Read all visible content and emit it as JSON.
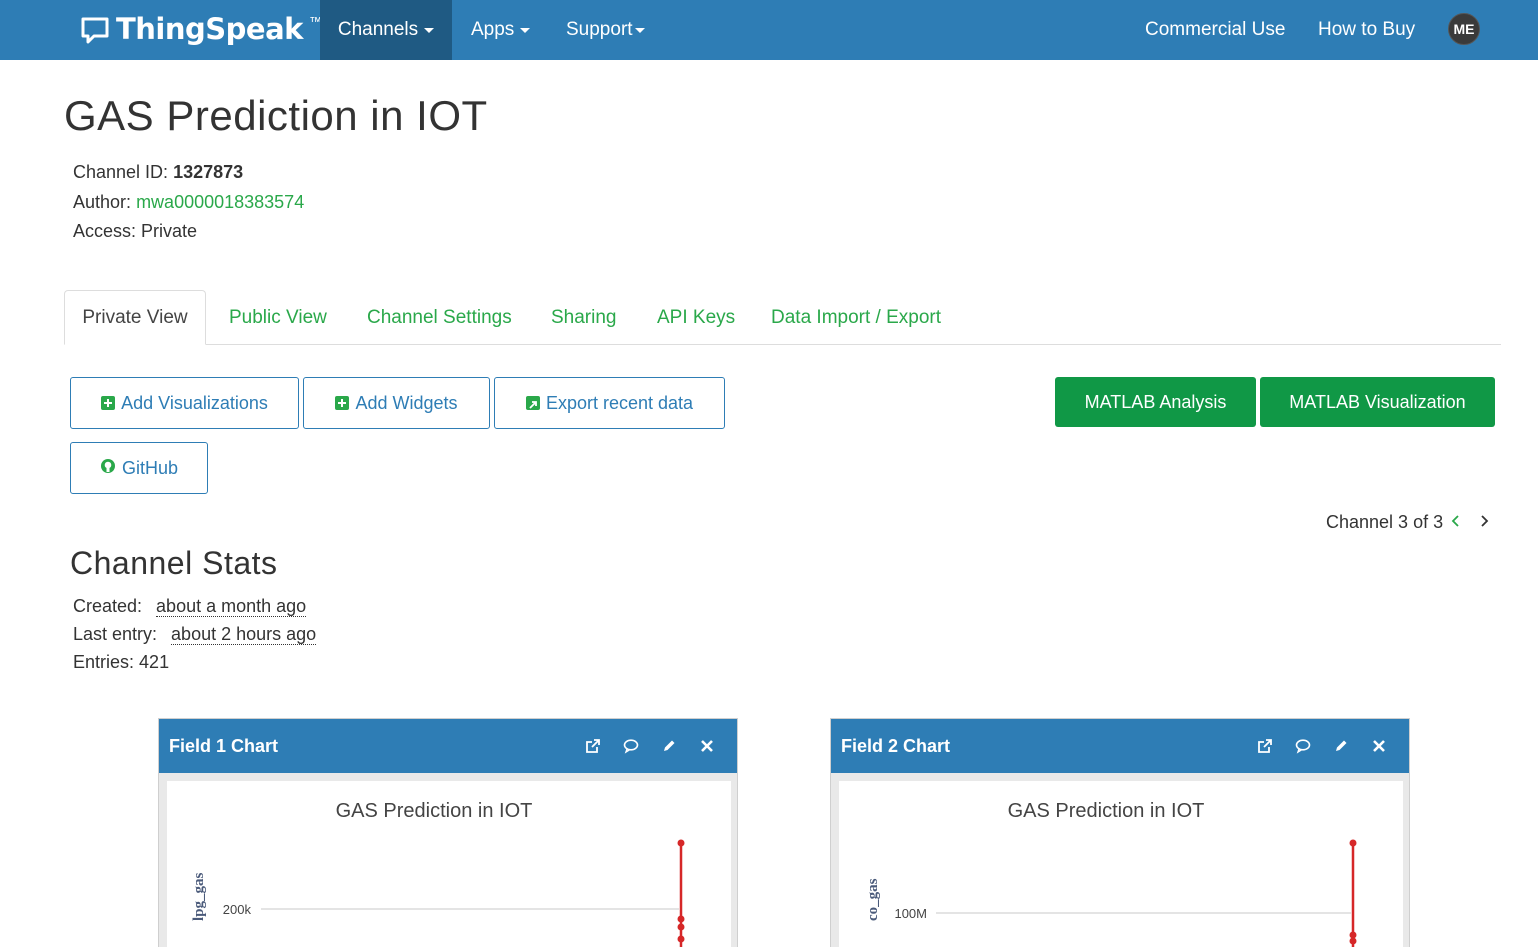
{
  "navbar": {
    "brand": "ThingSpeak",
    "brand_tm": "™",
    "items": [
      "Channels",
      "Apps",
      "Support"
    ],
    "right_items": [
      "Commercial Use",
      "How to Buy"
    ],
    "avatar": "ME",
    "color": "#2e7db5"
  },
  "channel": {
    "title": "GAS Prediction in IOT",
    "id_label": "Channel ID:",
    "id": "1327873",
    "author_label": "Author:",
    "author": "mwa0000018383574",
    "access_label": "Access:",
    "access": "Private"
  },
  "tabs": [
    "Private View",
    "Public View",
    "Channel Settings",
    "Sharing",
    "API Keys",
    "Data Import / Export"
  ],
  "buttons": {
    "add_visualizations": "Add Visualizations",
    "add_widgets": "Add Widgets",
    "export_recent": "Export recent data",
    "github": "GitHub",
    "matlab_analysis": "MATLAB Analysis",
    "matlab_visualization": "MATLAB Visualization"
  },
  "channel_nav": {
    "label": "Channel 3 of 3"
  },
  "stats": {
    "title": "Channel Stats",
    "created_label": "Created:",
    "created": "about a month ago",
    "last_entry_label": "Last entry:",
    "last_entry": "about 2 hours ago",
    "entries_label": "Entries:",
    "entries": "421"
  },
  "panels": [
    {
      "title": "Field 1 Chart",
      "chart_title": "GAS Prediction in IOT",
      "ylabel": "lpg_gas",
      "tick": "200k"
    },
    {
      "title": "Field 2 Chart",
      "chart_title": "GAS Prediction in IOT",
      "ylabel": "co_gas",
      "tick": "100M"
    }
  ],
  "chart_data": [
    {
      "type": "line",
      "title": "GAS Prediction in IOT",
      "ylabel": "lpg_gas",
      "yticks": [
        "200k"
      ],
      "series": [
        {
          "color": "#d62728"
        }
      ]
    },
    {
      "type": "line",
      "title": "GAS Prediction in IOT",
      "ylabel": "co_gas",
      "yticks": [
        "100M"
      ],
      "series": [
        {
          "color": "#d62728"
        }
      ]
    }
  ],
  "colors": {
    "accent_green": "#2aa84a",
    "button_green": "#109846",
    "series_red": "#d62728"
  }
}
